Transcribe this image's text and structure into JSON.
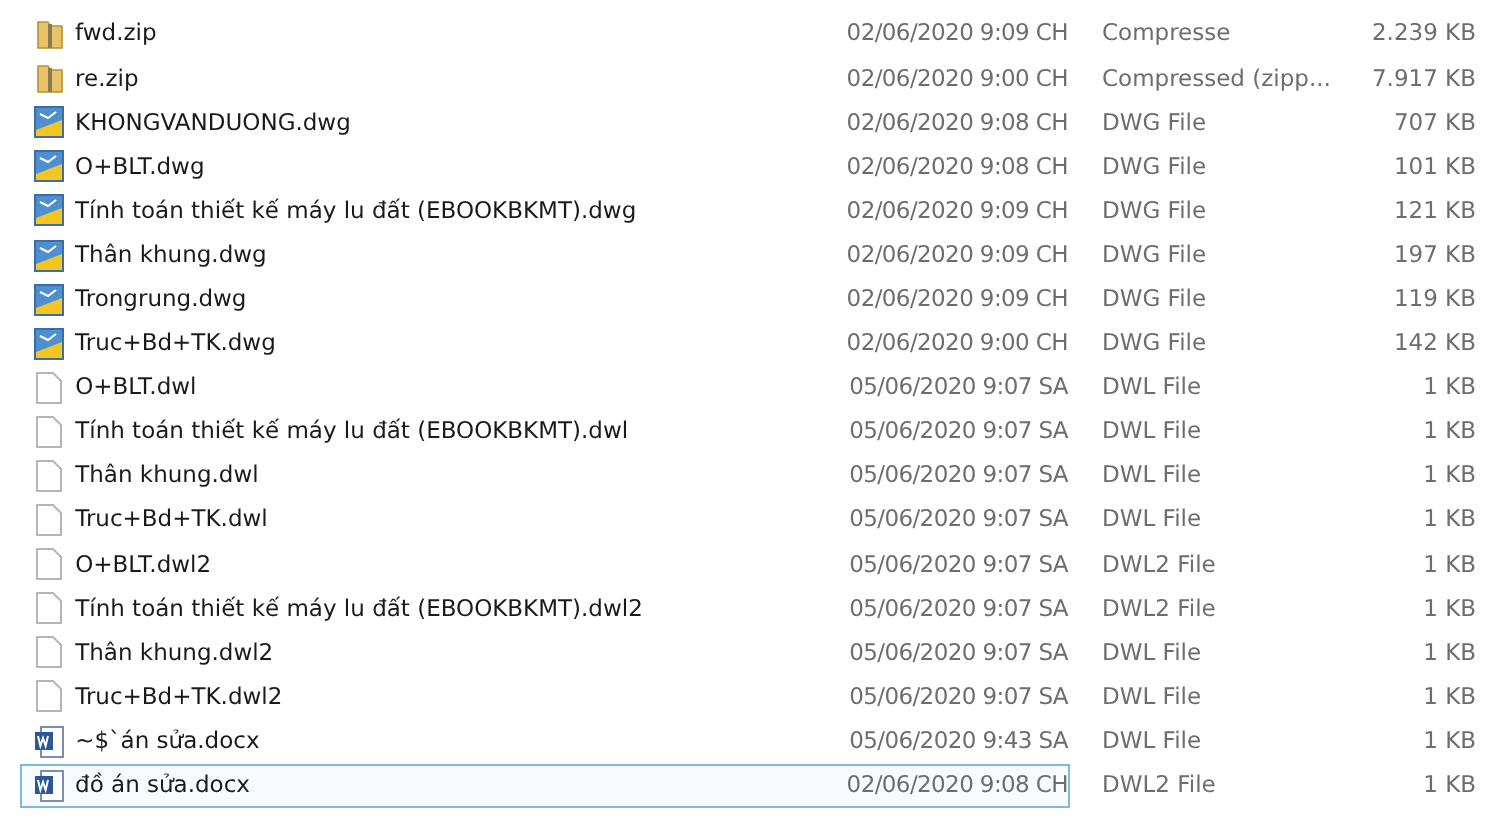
{
  "files": [
    {
      "name": "fwd.zip",
      "kind": "zip",
      "date": "02/06/2020 9:09 CH",
      "type": "Compresse",
      "size": "2.239 KB",
      "selected": false
    },
    {
      "name": "re.zip",
      "kind": "zip",
      "date": "02/06/2020 9:00 CH",
      "type": "Compressed (zipp...",
      "size": "7.917 KB",
      "selected": false
    },
    {
      "name": "KHONGVANDUONG.dwg",
      "kind": "dwg",
      "date": "02/06/2020 9:08 CH",
      "type": "DWG File",
      "size": "707 KB",
      "selected": false
    },
    {
      "name": "O+BLT.dwg",
      "kind": "dwg",
      "date": "02/06/2020 9:08 CH",
      "type": "DWG File",
      "size": "101 KB",
      "selected": false
    },
    {
      "name": "Tính toán thiết kế máy lu đất (EBOOKBKMT).dwg",
      "kind": "dwg",
      "date": "02/06/2020 9:09 CH",
      "type": "DWG File",
      "size": "121 KB",
      "selected": false
    },
    {
      "name": "Thân khung.dwg",
      "kind": "dwg",
      "date": "02/06/2020 9:09 CH",
      "type": "DWG File",
      "size": "197 KB",
      "selected": false
    },
    {
      "name": "Trongrung.dwg",
      "kind": "dwg",
      "date": "02/06/2020 9:09 CH",
      "type": "DWG File",
      "size": "119 KB",
      "selected": false
    },
    {
      "name": "Truc+Bd+TK.dwg",
      "kind": "dwg",
      "date": "02/06/2020 9:00 CH",
      "type": "DWG File",
      "size": "142 KB",
      "selected": false
    },
    {
      "name": "O+BLT.dwl",
      "kind": "blank",
      "date": "05/06/2020 9:07 SA",
      "type": "DWL File",
      "size": "1 KB",
      "selected": false
    },
    {
      "name": "Tính toán thiết kế máy lu đất (EBOOKBKMT).dwl",
      "kind": "blank",
      "date": "05/06/2020 9:07 SA",
      "type": "DWL File",
      "size": "1 KB",
      "selected": false
    },
    {
      "name": "Thân khung.dwl",
      "kind": "blank",
      "date": "05/06/2020 9:07 SA",
      "type": "DWL File",
      "size": "1 KB",
      "selected": false
    },
    {
      "name": "Truc+Bd+TK.dwl",
      "kind": "blank",
      "date": "05/06/2020 9:07 SA",
      "type": "DWL File",
      "size": "1 KB",
      "selected": false
    },
    {
      "name": "O+BLT.dwl2",
      "kind": "blank",
      "date": "05/06/2020 9:07 SA",
      "type": "DWL2 File",
      "size": "1 KB",
      "selected": false
    },
    {
      "name": "Tính toán thiết kế máy lu đất (EBOOKBKMT).dwl2",
      "kind": "blank",
      "date": "05/06/2020 9:07 SA",
      "type": "DWL2 File",
      "size": "1 KB",
      "selected": false
    },
    {
      "name": "Thân khung.dwl2",
      "kind": "blank",
      "date": "05/06/2020 9:07 SA",
      "type": "DWL File",
      "size": "1 KB",
      "selected": false
    },
    {
      "name": "Truc+Bd+TK.dwl2",
      "kind": "blank",
      "date": "05/06/2020 9:07 SA",
      "type": "DWL File",
      "size": "1 KB",
      "selected": false
    },
    {
      "name": "~$`án sửa.docx",
      "kind": "word",
      "date": "05/06/2020 9:43 SA",
      "type": "DWL File",
      "size": "1 KB",
      "selected": false
    },
    {
      "name": "đồ án sửa.docx",
      "kind": "word",
      "date": "02/06/2020 9:08 CH",
      "type": "DWL2 File",
      "size": "1 KB",
      "selected": true
    }
  ]
}
